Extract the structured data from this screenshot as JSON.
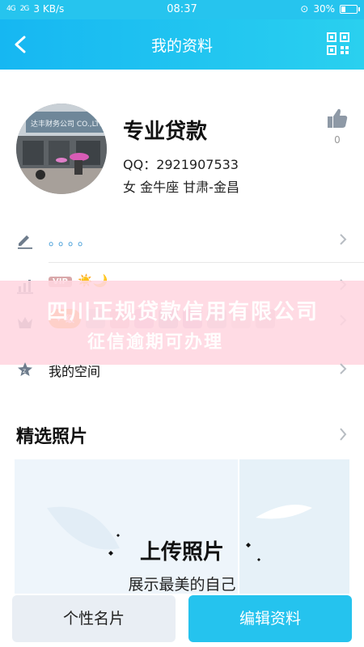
{
  "status_bar": {
    "speed": "3 KB/s",
    "time": "08:37",
    "battery": "30%",
    "battery_level": 0.3,
    "signal_1": "4G",
    "signal_2": "2G"
  },
  "navbar": {
    "title": "我的资料",
    "back_icon": "back-arrow-icon",
    "qr_icon": "qr-code-icon"
  },
  "profile": {
    "name": "专业贷款",
    "qq": "QQ：2921907533",
    "info": "女  金牛座  甘肃-金昌",
    "like_count": "0",
    "avatar_sign_text": "达丰财务公司 CO.,LTD."
  },
  "rows": {
    "signature": "。。。。",
    "vip_badge": "VIP",
    "vip_icons": "☀️🌙",
    "badge_pill": "✦ 级",
    "space_label": "我的空间"
  },
  "watermark": {
    "line1": "四川正规贷款信用有限公司",
    "line2": "征信逾期可办理"
  },
  "photos": {
    "section_title": "精选照片",
    "upload_title": "上传照片",
    "upload_subtitle": "展示最美的自己"
  },
  "bottom": {
    "card_button": "个性名片",
    "edit_button": "编辑资料"
  },
  "colors": {
    "accent": "#25c3ee",
    "watermark_bg": "#ffd6e0"
  }
}
